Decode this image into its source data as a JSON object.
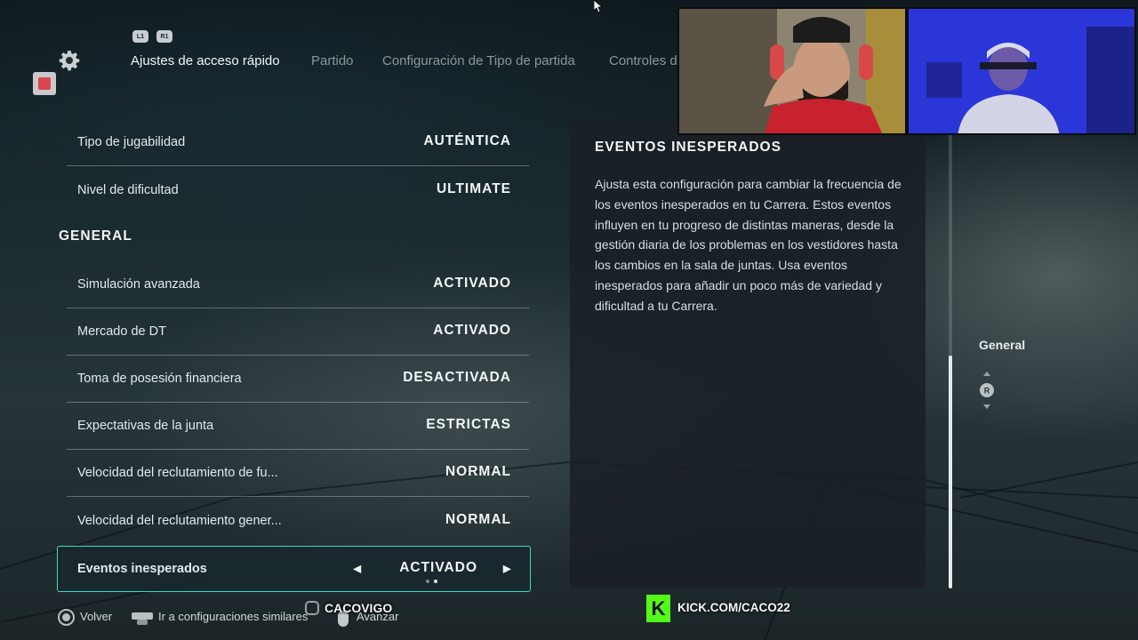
{
  "nav": {
    "bumper_left": "L1",
    "bumper_right": "R1",
    "tabs": [
      {
        "label": "Ajustes de acceso rápido",
        "active": true
      },
      {
        "label": "Partido",
        "active": false
      },
      {
        "label": "Configuración de Tipo de partida",
        "active": false
      },
      {
        "label": "Controles d",
        "active": false
      }
    ]
  },
  "settings": {
    "top_rows": [
      {
        "label": "Tipo de jugabilidad",
        "value": "AUTÉNTICA"
      },
      {
        "label": "Nivel de dificultad",
        "value": "ULTIMATE"
      }
    ],
    "section_title": "GENERAL",
    "general_rows": [
      {
        "label": "Simulación avanzada",
        "value": "ACTIVADO"
      },
      {
        "label": "Mercado de DT",
        "value": "ACTIVADO"
      },
      {
        "label": "Toma de posesión financiera",
        "value": "DESACTIVADA"
      },
      {
        "label": "Expectativas de la junta",
        "value": "ESTRICTAS"
      },
      {
        "label": "Velocidad del reclutamiento de fu...",
        "value": "NORMAL"
      },
      {
        "label": "Velocidad del reclutamiento gener...",
        "value": "NORMAL"
      }
    ],
    "selected_row": {
      "label": "Eventos inesperados",
      "value": "ACTIVADO",
      "option_index": 2,
      "option_count": 2
    }
  },
  "description": {
    "title": "EVENTOS INESPERADOS",
    "body": "Ajusta esta configuración para cambiar la frecuencia de los eventos inesperados en tu Carrera. Estos eventos influyen en tu progreso de distintas maneras, desde la gestión diaria de los problemas en los vestidores hasta los cambios en la sala de juntas. Usa eventos inesperados para añadir un poco más de variedad y dificultad a tu Carrera."
  },
  "side_nav": {
    "label": "General",
    "stick": "R"
  },
  "footer": {
    "back": "Volver",
    "similar": "Ir a configuraciones similares",
    "advance": "Avanzar"
  },
  "overlay": {
    "watermark": "CACOVIGO",
    "kick_url": "KICK.COM/CACO22",
    "kick_logo": "K"
  },
  "colors": {
    "accent": "#3fd9c3",
    "kick": "#53fc18"
  }
}
